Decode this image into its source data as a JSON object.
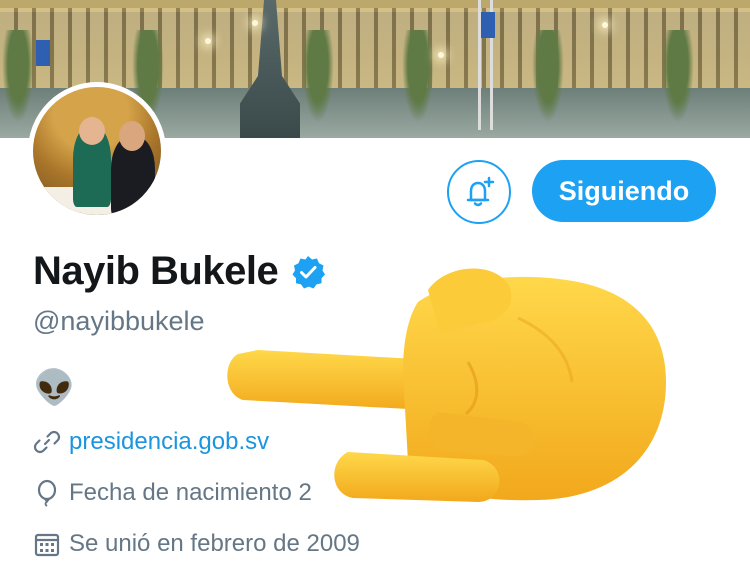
{
  "profile": {
    "name": "Nayib Bukele",
    "handle": "@nayibbukele",
    "bio_emoji": "👽",
    "website": "presidencia.gob.sv",
    "birthday": "Fecha de nacimiento 2",
    "joined": "Se unió en febrero de 2009"
  },
  "actions": {
    "follow_label": "Siguiendo"
  },
  "icons": {
    "notifications": "bell-plus-icon",
    "verified": "verified-badge-icon",
    "link": "link-icon",
    "birthday": "balloon-icon",
    "joined": "calendar-icon",
    "overlay": "pointing-hand-emoji"
  },
  "colors": {
    "accent": "#1da1f2",
    "link": "#1b95e0",
    "muted": "#657786",
    "text": "#14171a"
  }
}
